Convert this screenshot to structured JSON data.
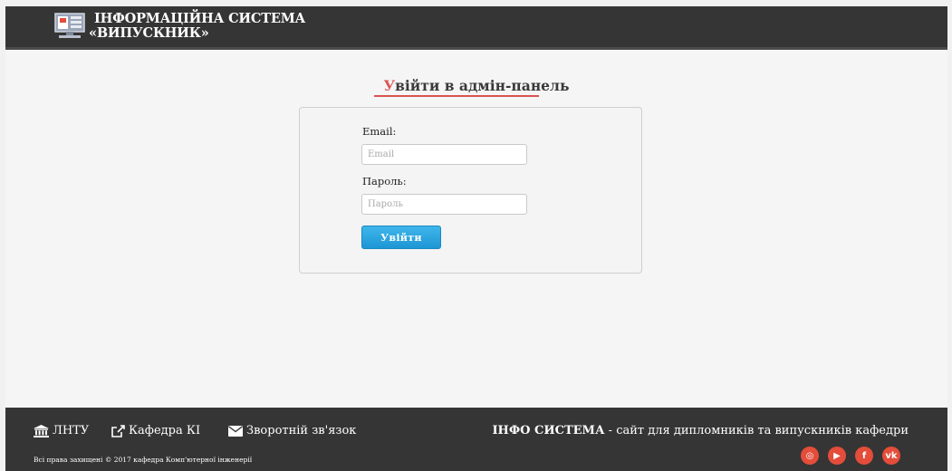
{
  "header": {
    "title_line1": "ІНФОРМАЦІЙНА СИСТЕМА",
    "title_line2": "«ВИПУСКНИК»"
  },
  "login": {
    "title_first": "У",
    "title_rest": "війти в адмін-панель",
    "email_label": "Email:",
    "email_placeholder": "Email",
    "email_value": "",
    "password_label": "Пароль:",
    "password_placeholder": "Пароль",
    "password_value": "",
    "submit_label": "Увійти"
  },
  "footer": {
    "links": [
      {
        "label": "ЛНТУ",
        "icon": "university-icon"
      },
      {
        "label": "Кафедра КІ",
        "icon": "external-link-icon"
      },
      {
        "label": "Зворотній зв'язок",
        "icon": "envelope-icon"
      }
    ],
    "tagline_bold": "ІНФО СИСТЕМА",
    "tagline_rest": " - сайт для дипломників та випускників кафедри",
    "copyright": "Всі права захищені © 2017 кафедра Комп'ютерної інженерії",
    "social": [
      {
        "icon": "instagram-icon",
        "glyph": "◎"
      },
      {
        "icon": "youtube-icon",
        "glyph": "▶"
      },
      {
        "icon": "facebook-icon",
        "glyph": "f"
      },
      {
        "icon": "vk-icon",
        "glyph": "vk"
      }
    ]
  },
  "colors": {
    "header_bg": "#353535",
    "accent_red": "#d9534f",
    "button_blue": "#1d96d5",
    "social_red": "#e34d3a"
  }
}
